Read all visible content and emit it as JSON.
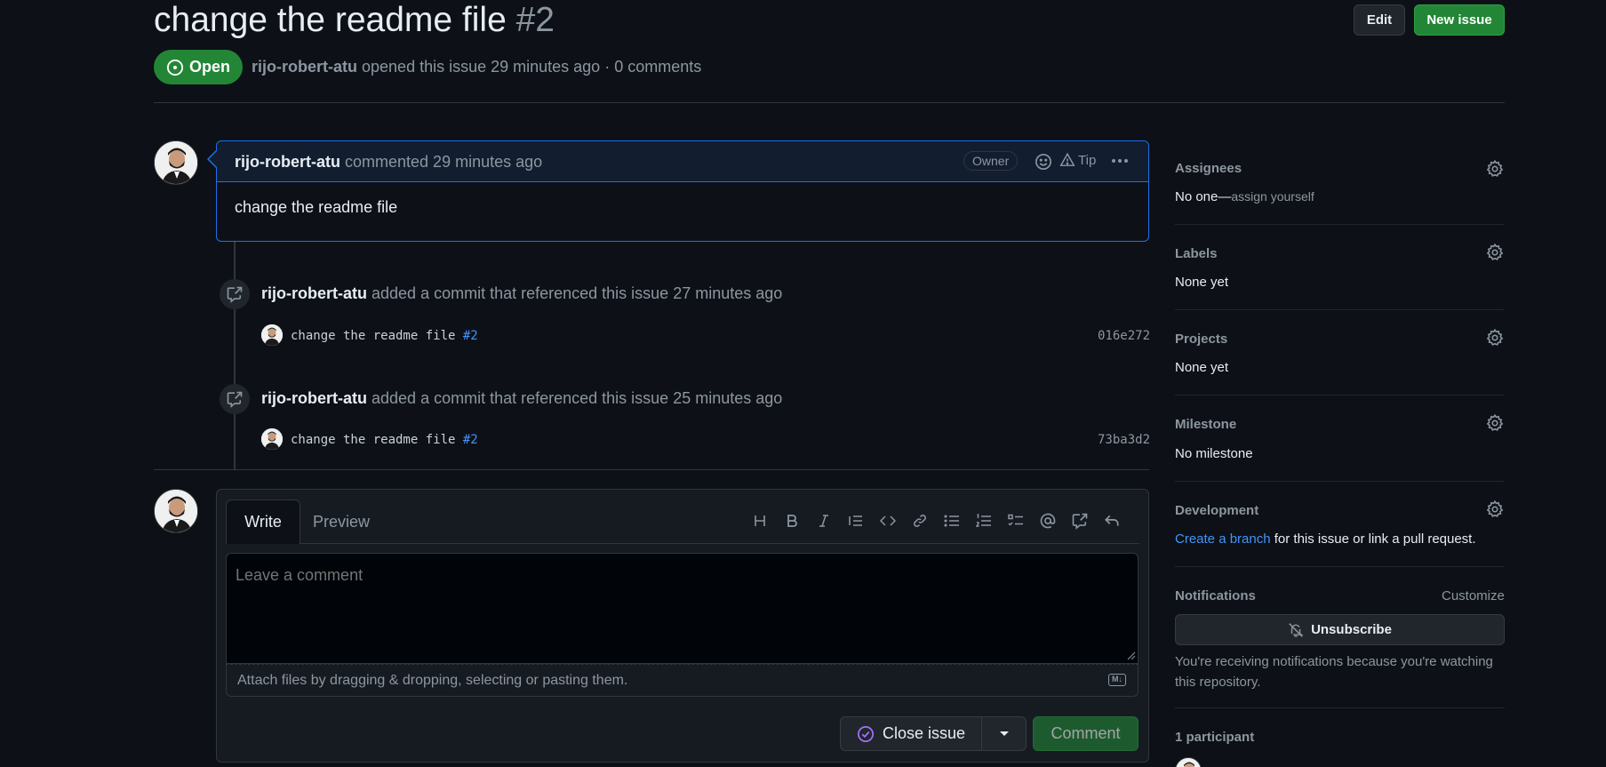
{
  "issue": {
    "title": "change the readme file",
    "number": "#2",
    "state": "Open",
    "author": "rijo-robert-atu",
    "meta_text": "opened this issue 29 minutes ago · 0 comments"
  },
  "header": {
    "edit_label": "Edit",
    "new_issue_label": "New issue"
  },
  "comment": {
    "author": "rijo-robert-atu",
    "action": "commented 29 minutes ago",
    "role_badge": "Owner",
    "tip_label": "Tip",
    "body": "change the readme file"
  },
  "events": [
    {
      "author": "rijo-robert-atu",
      "text": "added a commit that referenced this issue 27 minutes ago",
      "commit_message": "change the readme file",
      "commit_ref": "#2",
      "sha": "016e272"
    },
    {
      "author": "rijo-robert-atu",
      "text": "added a commit that referenced this issue 25 minutes ago",
      "commit_message": "change the readme file",
      "commit_ref": "#2",
      "sha": "73ba3d2"
    }
  ],
  "new_comment": {
    "tab_write": "Write",
    "tab_preview": "Preview",
    "placeholder": "Leave a comment",
    "attach_text": "Attach files by dragging & dropping, selecting or pasting them.",
    "md_badge": "M↓",
    "close_issue_label": "Close issue",
    "comment_label": "Comment"
  },
  "sidebar": {
    "assignees": {
      "title": "Assignees",
      "value": "No one—",
      "link": "assign yourself"
    },
    "labels": {
      "title": "Labels",
      "value": "None yet"
    },
    "projects": {
      "title": "Projects",
      "value": "None yet"
    },
    "milestone": {
      "title": "Milestone",
      "value": "No milestone"
    },
    "development": {
      "title": "Development",
      "link": "Create a branch",
      "value": " for this issue or link a pull request."
    },
    "notifications": {
      "title": "Notifications",
      "customize": "Customize",
      "unsubscribe_label": "Unsubscribe",
      "reason": "You're receiving notifications because you're watching this repository."
    },
    "participants": {
      "title": "1 participant"
    }
  },
  "colors": {
    "accent": "#4493f8",
    "success": "#238636",
    "bg": "#0d1117"
  }
}
